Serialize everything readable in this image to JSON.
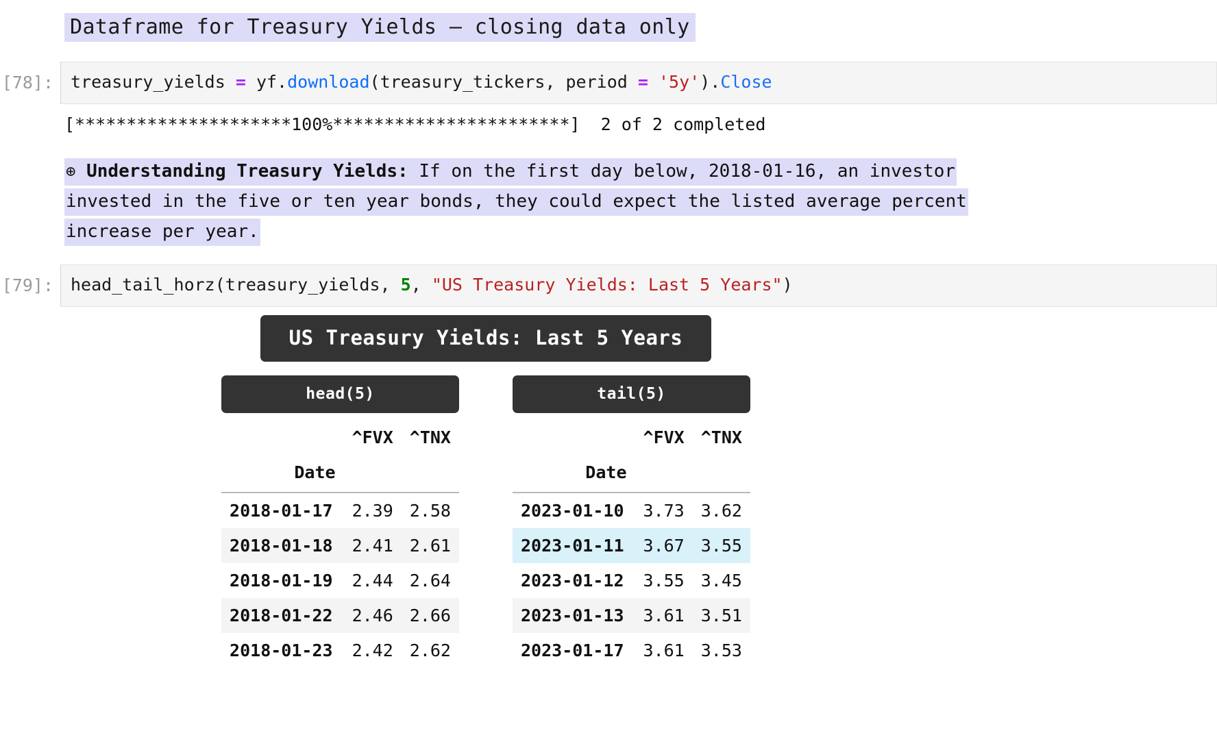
{
  "markdown_heading": {
    "text": "Dataframe for Treasury Yields — closing data only",
    "highlight_color": "#dcdcf8"
  },
  "cells": [
    {
      "prompt": "[78]:",
      "code_plain": "treasury_yields = yf.download(treasury_tickers, period = '5y').Close",
      "code_tokens": {
        "var": "treasury_yields ",
        "eq": "=",
        "mod": " yf.",
        "fn": "download",
        "args": "(treasury_tickers, period ",
        "eq2": "=",
        "sp": " ",
        "str": "'5y'",
        "close_paren": ").",
        "attr": "Close"
      },
      "output": "[*********************100%***********************]  2 of 2 completed"
    },
    {
      "prompt": "[79]:",
      "code_plain": "head_tail_horz(treasury_yields, 5, \"US Treasury Yields: Last 5 Years\")",
      "code_tokens": {
        "fn": "head_tail_horz",
        "args": "(treasury_yields, ",
        "num": "5",
        "comma": ", ",
        "str": "\"US Treasury Yields: Last 5 Years\"",
        "close_paren": ")"
      }
    }
  ],
  "markdown_note": {
    "bullet": "⊕",
    "bold_lead": "Understanding Treasury Yields:",
    "body": " If on the first day below, 2018-01-16, an investor invested in the five or ten year bonds, they could expect the listed average percent increase per year.",
    "highlight_color": "#dcdcf8"
  },
  "dataframe_output": {
    "title": "US Treasury Yields: Last 5 Years",
    "title_bg": "#333333",
    "hover_row_color": "#d9f1f9",
    "alt_row_color": "#f4f4f4",
    "tables": [
      {
        "caption": "head(5)",
        "index_name": "Date",
        "columns": [
          "^FVX",
          "^TNX"
        ],
        "rows": [
          {
            "date": "2018-01-17",
            "fvx": "2.39",
            "tnx": "2.58",
            "style": "plain"
          },
          {
            "date": "2018-01-18",
            "fvx": "2.41",
            "tnx": "2.61",
            "style": "alt"
          },
          {
            "date": "2018-01-19",
            "fvx": "2.44",
            "tnx": "2.64",
            "style": "plain"
          },
          {
            "date": "2018-01-22",
            "fvx": "2.46",
            "tnx": "2.66",
            "style": "alt"
          },
          {
            "date": "2018-01-23",
            "fvx": "2.42",
            "tnx": "2.62",
            "style": "plain"
          }
        ]
      },
      {
        "caption": "tail(5)",
        "index_name": "Date",
        "columns": [
          "^FVX",
          "^TNX"
        ],
        "rows": [
          {
            "date": "2023-01-10",
            "fvx": "3.73",
            "tnx": "3.62",
            "style": "plain"
          },
          {
            "date": "2023-01-11",
            "fvx": "3.67",
            "tnx": "3.55",
            "style": "hover"
          },
          {
            "date": "2023-01-12",
            "fvx": "3.55",
            "tnx": "3.45",
            "style": "plain"
          },
          {
            "date": "2023-01-13",
            "fvx": "3.61",
            "tnx": "3.51",
            "style": "alt"
          },
          {
            "date": "2023-01-17",
            "fvx": "3.61",
            "tnx": "3.53",
            "style": "plain"
          }
        ]
      }
    ]
  },
  "chart_data": {
    "type": "table",
    "title": "US Treasury Yields: Last 5 Years",
    "columns": [
      "Date",
      "^FVX",
      "^TNX"
    ],
    "head": [
      [
        "2018-01-17",
        2.39,
        2.58
      ],
      [
        "2018-01-18",
        2.41,
        2.61
      ],
      [
        "2018-01-19",
        2.44,
        2.64
      ],
      [
        "2018-01-22",
        2.46,
        2.66
      ],
      [
        "2018-01-23",
        2.42,
        2.62
      ]
    ],
    "tail": [
      [
        "2023-01-10",
        3.73,
        3.62
      ],
      [
        "2023-01-11",
        3.67,
        3.55
      ],
      [
        "2023-01-12",
        3.55,
        3.45
      ],
      [
        "2023-01-13",
        3.61,
        3.51
      ],
      [
        "2023-01-17",
        3.61,
        3.53
      ]
    ]
  }
}
